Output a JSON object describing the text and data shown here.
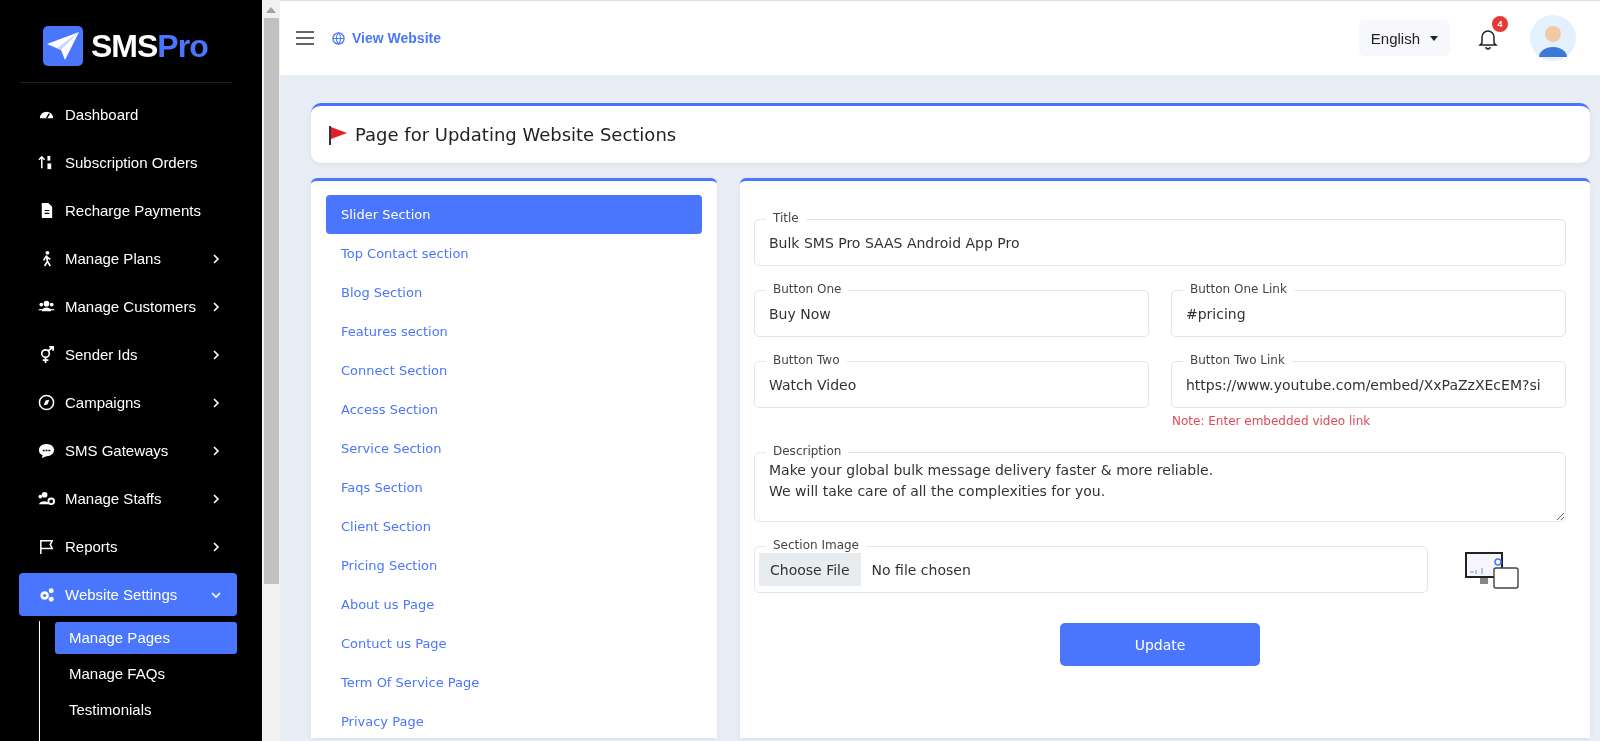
{
  "sidebar": {
    "logo": {
      "text_main": "SMS",
      "text_accent": "Pro"
    },
    "items": [
      {
        "label": "Dashboard",
        "kind": "link"
      },
      {
        "label": "Subscription Orders",
        "kind": "link"
      },
      {
        "label": "Recharge Payments",
        "kind": "link"
      },
      {
        "label": "Manage Plans",
        "kind": "group",
        "expanded": false
      },
      {
        "label": "Manage Customers",
        "kind": "group",
        "expanded": false
      },
      {
        "label": "Sender Ids",
        "kind": "group",
        "expanded": false
      },
      {
        "label": "Campaigns",
        "kind": "group",
        "expanded": false
      },
      {
        "label": "SMS Gateways",
        "kind": "group",
        "expanded": false
      },
      {
        "label": "Manage Staffs",
        "kind": "group",
        "expanded": false
      },
      {
        "label": "Reports",
        "kind": "group",
        "expanded": false
      },
      {
        "label": "Website Settings",
        "kind": "group",
        "expanded": true,
        "selected": true,
        "children": [
          {
            "label": "Manage Pages",
            "selected": true
          },
          {
            "label": "Manage FAQs",
            "selected": false
          },
          {
            "label": "Testimonials",
            "selected": false
          }
        ]
      }
    ]
  },
  "header": {
    "view_website": "View Website",
    "language": "English",
    "notification_count": "4"
  },
  "page_title": "Page for Updating Website Sections",
  "sections": [
    {
      "label": "Slider Section",
      "selected": true
    },
    {
      "label": "Top Contact section",
      "selected": false
    },
    {
      "label": "Blog Section",
      "selected": false
    },
    {
      "label": "Features section",
      "selected": false
    },
    {
      "label": "Connect Section",
      "selected": false
    },
    {
      "label": "Access Section",
      "selected": false
    },
    {
      "label": "Service Section",
      "selected": false
    },
    {
      "label": "Faqs Section",
      "selected": false
    },
    {
      "label": "Client Section",
      "selected": false
    },
    {
      "label": "Pricing Section",
      "selected": false
    },
    {
      "label": "About us Page",
      "selected": false
    },
    {
      "label": "Contuct us Page",
      "selected": false
    },
    {
      "label": "Term Of Service Page",
      "selected": false
    },
    {
      "label": "Privacy Page",
      "selected": false
    }
  ],
  "form": {
    "rows": [
      [
        {
          "kind": "text",
          "label": "Title",
          "value": "Bulk SMS Pro SAAS Android App Pro"
        }
      ],
      [
        {
          "kind": "text",
          "label": "Button One",
          "value": "Buy Now"
        },
        {
          "kind": "text",
          "label": "Button One Link",
          "value": "#pricing"
        }
      ],
      [
        {
          "kind": "text",
          "label": "Button Two",
          "value": "Watch Video"
        },
        {
          "kind": "text",
          "label": "Button Two Link",
          "value": "https://www.youtube.com/embed/XxPaZzXEcEM?si",
          "note": "Note: Enter embedded video link"
        }
      ],
      [
        {
          "kind": "textarea",
          "label": "Description",
          "value": "Make your global bulk message delivery faster & more reliable.\nWe will take care of all the complexities for you."
        }
      ],
      [
        {
          "kind": "file",
          "label": "Section Image",
          "button": "Choose File",
          "status": "No file chosen"
        }
      ]
    ],
    "submit": "Update"
  }
}
